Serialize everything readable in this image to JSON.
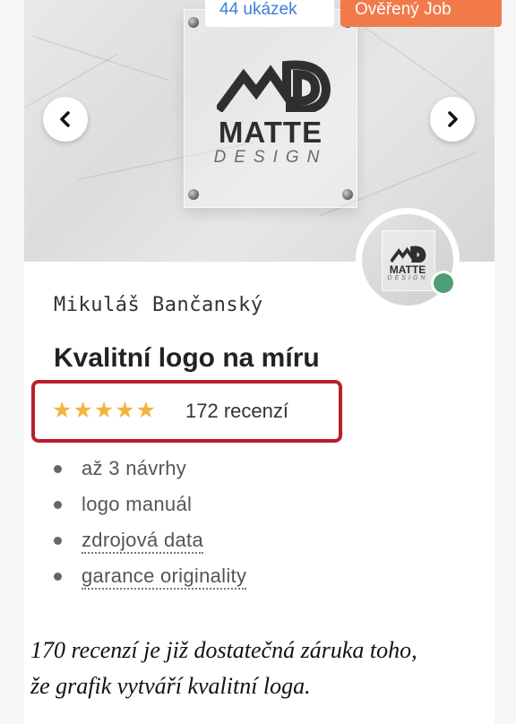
{
  "badges": {
    "samples": "44 ukázek",
    "verified": "Ověřený Job"
  },
  "hero_logo": {
    "word": "MATTE",
    "sub": "DESIGN"
  },
  "carousel": {
    "prev_icon": "chevron-left-icon",
    "next_icon": "chevron-right-icon"
  },
  "seller": {
    "name": "Mikuláš Bančanský",
    "online_status_color": "#4f9e78"
  },
  "listing": {
    "title": "Kvalitní logo na míru",
    "stars": "★★★★★",
    "rating": 5,
    "reviews_text": "172 recenzí",
    "features": [
      {
        "text": "až 3 návrhy"
      },
      {
        "text": "logo manuál"
      },
      {
        "text": "zdrojová data"
      },
      {
        "text": "garance originality"
      }
    ]
  },
  "annotation": {
    "line1": "170 recenzí je již dostatečná záruka toho,",
    "line2": "že grafik vytváří kvalitní loga."
  },
  "colors": {
    "verified_badge": "#f27a4a",
    "samples_text": "#3d7fd9",
    "highlight_border": "#b81f2b",
    "stars": "#f2b53d"
  }
}
